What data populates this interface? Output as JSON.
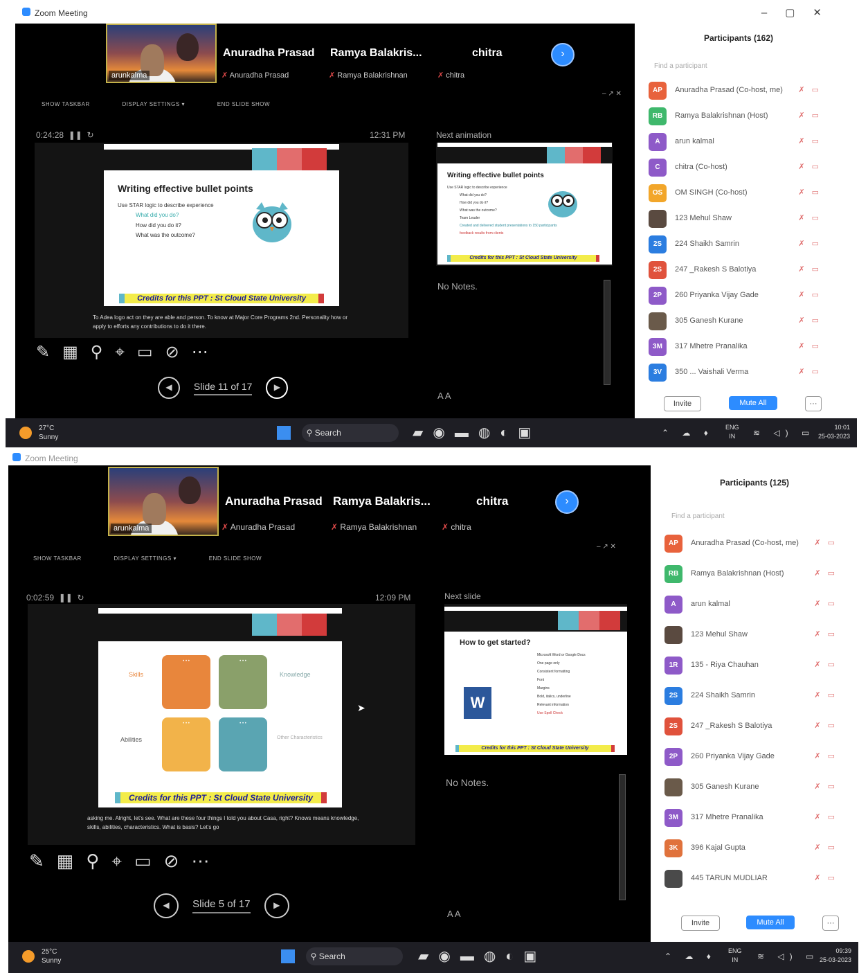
{
  "top": {
    "window_title": "Zoom Meeting",
    "window_controls": [
      "–",
      "▢",
      "✕"
    ],
    "video": {
      "thumb_label": "arunkalma",
      "names": [
        "Anuradha Prasad",
        "Ramya Balakris...",
        "chitra"
      ],
      "subnames": [
        "Anuradha Prasad",
        "Ramya Balakrishnan",
        "chitra"
      ]
    },
    "toolbar": [
      "SHOW TASKBAR",
      "DISPLAY SETTINGS ▾",
      "END SLIDE SHOW"
    ],
    "timer": "0:24:28",
    "clock": "12:31 PM",
    "next_label": "Next animation",
    "slide": {
      "title": "Writing effective bullet points",
      "lines": [
        "Use STAR logic to describe experience",
        "What did you do?",
        "How did you do it?",
        "What was the outcome?"
      ],
      "credits": "Credits for this PPT : St Cloud State University"
    },
    "next_slide": {
      "title": "Writing effective bullet points",
      "lines": [
        "Use STAR logic to describe experience",
        "What did you do?",
        "How did you do it?",
        "What was the outcome?",
        "Team Leader",
        "Created and delivered student presentations to 150 participants",
        "feedback results from clients"
      ],
      "credits": "Credits for this PPT : St Cloud State University"
    },
    "speaker_text": "To Adea logo act on they are able and person. To know at Major Core Programs 2nd. Personality how or apply to efforts any contributions to do it there.",
    "notes": "No Notes.",
    "slide_counter": "Slide 11 of 17",
    "font_controls": "A  A",
    "participants": {
      "title": "Participants (162)",
      "search_placeholder": "Find a participant",
      "rows": [
        {
          "initials": "AP",
          "color": "#e8623c",
          "name": "Anuradha Prasad (Co-host, me)"
        },
        {
          "initials": "RB",
          "color": "#3fb86c",
          "name": "Ramya Balakrishnan (Host)"
        },
        {
          "initials": "A",
          "color": "#8e5ac8",
          "name": "arun kalmal"
        },
        {
          "initials": "C",
          "color": "#8e5ac8",
          "name": "chitra (Co-host)"
        },
        {
          "initials": "OS",
          "color": "#f2a62a",
          "name": "OM SINGH (Co-host)"
        },
        {
          "initials": "",
          "color": "#5a4a40",
          "name": "123 Mehul Shaw"
        },
        {
          "initials": "2S",
          "color": "#2b7de0",
          "name": "224 Shaikh Samrin"
        },
        {
          "initials": "2S",
          "color": "#e0523c",
          "name": "247 _Rakesh S Balotiya"
        },
        {
          "initials": "2P",
          "color": "#8e5ac8",
          "name": "260 Priyanka Vijay Gade"
        },
        {
          "initials": "",
          "color": "#6a5a4a",
          "name": "305 Ganesh Kurane"
        },
        {
          "initials": "3M",
          "color": "#8e5ac8",
          "name": "317 Mhetre Pranalika"
        },
        {
          "initials": "3V",
          "color": "#2b7de0",
          "name": "350 ... Vaishali Verma"
        }
      ],
      "invite": "Invite",
      "mute_all": "Mute All",
      "more": "···"
    },
    "taskbar": {
      "temp": "27°C",
      "weather": "Sunny",
      "search": "Search",
      "lang1": "ENG",
      "lang2": "IN",
      "time": "10:01",
      "date": "25-03-2023"
    }
  },
  "bottom": {
    "window_title": "Zoom Meeting",
    "video": {
      "thumb_label": "arunkalma",
      "names": [
        "Anuradha Prasad",
        "Ramya Balakris...",
        "chitra"
      ],
      "subnames": [
        "Anuradha Prasad",
        "Ramya Balakrishnan",
        "chitra"
      ]
    },
    "toolbar": [
      "SHOW TASKBAR",
      "DISPLAY SETTINGS ▾",
      "END SLIDE SHOW"
    ],
    "timer": "0:02:59",
    "clock": "12:09 PM",
    "next_label": "Next slide",
    "slide": {
      "labels": [
        "Skills",
        "Knowledge",
        "Abilities",
        "Other Characteristics"
      ],
      "credits": "Credits for this PPT : St Cloud State University"
    },
    "next_slide": {
      "title": "How to get started?",
      "lines": [
        "Microsoft Word or Google Docs",
        "One page only",
        "Consistent formatting",
        "Font",
        "Margins",
        "Bold, italics, underline",
        "Relevant information",
        "Use Spell Check"
      ],
      "credits": "Credits for this PPT : St Cloud State University"
    },
    "speaker_text": "asking me. Alright, let's see. What are these four things I told you about Casa, right? Knows means knowledge, skills, abilities, characteristics. What is basis? Let's go",
    "notes": "No Notes.",
    "slide_counter": "Slide 5 of 17",
    "font_controls": "A  A",
    "participants": {
      "title": "Participants (125)",
      "search_placeholder": "Find a participant",
      "rows": [
        {
          "initials": "AP",
          "color": "#e8623c",
          "name": "Anuradha Prasad (Co-host, me)"
        },
        {
          "initials": "RB",
          "color": "#3fb86c",
          "name": "Ramya Balakrishnan (Host)"
        },
        {
          "initials": "A",
          "color": "#8e5ac8",
          "name": "arun kalmal"
        },
        {
          "initials": "",
          "color": "#5a4a40",
          "name": "123 Mehul Shaw"
        },
        {
          "initials": "1R",
          "color": "#8e5ac8",
          "name": "135 - Riya Chauhan"
        },
        {
          "initials": "2S",
          "color": "#2b7de0",
          "name": "224 Shaikh Samrin"
        },
        {
          "initials": "2S",
          "color": "#e0523c",
          "name": "247 _Rakesh S Balotiya"
        },
        {
          "initials": "2P",
          "color": "#8e5ac8",
          "name": "260 Priyanka Vijay Gade"
        },
        {
          "initials": "",
          "color": "#6a5a4a",
          "name": "305 Ganesh Kurane"
        },
        {
          "initials": "3M",
          "color": "#8e5ac8",
          "name": "317 Mhetre Pranalika"
        },
        {
          "initials": "3K",
          "color": "#e0723c",
          "name": "396 Kajal Gupta"
        },
        {
          "initials": "",
          "color": "#4a4a4a",
          "name": "445 TARUN MUDLIAR"
        }
      ],
      "invite": "Invite",
      "mute_all": "Mute All",
      "more": "···"
    },
    "taskbar": {
      "temp": "25°C",
      "weather": "Sunny",
      "search": "Search",
      "lang1": "ENG",
      "lang2": "IN",
      "time": "09:39",
      "date": "25-03-2023"
    }
  }
}
